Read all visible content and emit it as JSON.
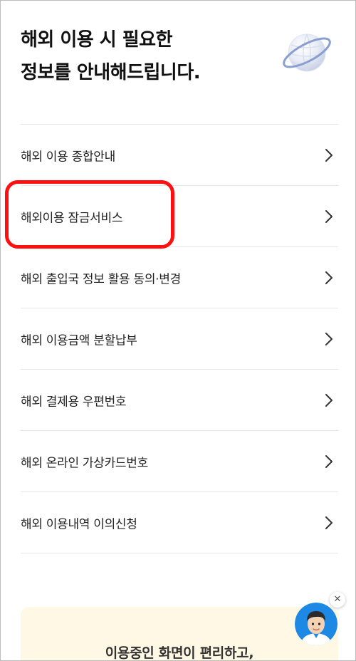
{
  "header": {
    "title_line1": "해외 이용 시 필요한",
    "title_line2": "정보를 안내해드립니다."
  },
  "icons": {
    "header": "globe-icon",
    "menu_arrow": "chevron-right-icon",
    "chat": "avatar-icon",
    "close": "close-icon"
  },
  "menu": {
    "items": [
      {
        "label": "해외 이용 종합안내"
      },
      {
        "label": "해외이용 잠금서비스"
      },
      {
        "label": "해외 출입국 정보 활용 동의·변경"
      },
      {
        "label": "해외 이용금액 분할납부"
      },
      {
        "label": "해외 결제용 우편번호"
      },
      {
        "label": "해외 온라인 가상카드번호"
      },
      {
        "label": "해외 이용내역 이의신청"
      }
    ]
  },
  "promo": {
    "text": "이용중인 화면이 편리하고,"
  },
  "floating": {
    "close_symbol": "✕"
  },
  "colors": {
    "highlight": "#ff1010",
    "promo_bg": "#fff8e4",
    "avatar_bg": "#1e88e5"
  }
}
